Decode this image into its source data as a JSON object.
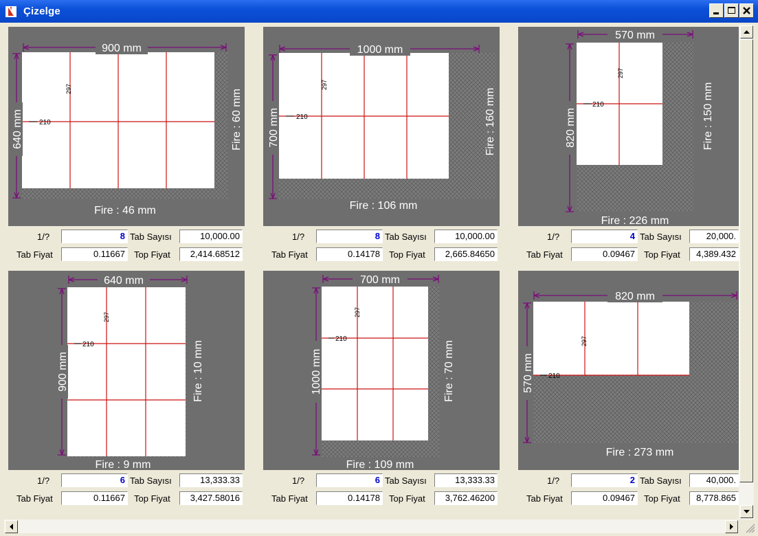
{
  "window": {
    "title": "Çizelge"
  },
  "labels": {
    "ratio": "1/?",
    "tab_count": "Tab Sayısı",
    "tab_price": "Tab Fiyat",
    "total_price": "Top Fiyat"
  },
  "panels": [
    {
      "width_label": "900 mm",
      "height_label": "640 mm",
      "waste_bottom": "Fire : 46 mm",
      "waste_right": "Fire : 60 mm",
      "cell_w": "210",
      "cell_h": "297",
      "ratio": "8",
      "tab_count": "10,000.00",
      "tab_price": "0.11667",
      "total_price": "2,414.68512"
    },
    {
      "width_label": "1000 mm",
      "height_label": "700 mm",
      "waste_bottom": "Fire : 106 mm",
      "waste_right": "Fire : 160 mm",
      "cell_w": "210",
      "cell_h": "297",
      "ratio": "8",
      "tab_count": "10,000.00",
      "tab_price": "0.14178",
      "total_price": "2,665.84650"
    },
    {
      "width_label": "570 mm",
      "height_label": "820 mm",
      "waste_bottom": "Fire : 226 mm",
      "waste_right": "Fire : 150 mm",
      "cell_w": "210",
      "cell_h": "297",
      "ratio": "4",
      "tab_count": "20,000.",
      "tab_price": "0.09467",
      "total_price": "4,389.432"
    },
    {
      "width_label": "640 mm",
      "height_label": "900 mm",
      "waste_bottom": "Fire : 9 mm",
      "waste_right": "Fire : 10 mm",
      "cell_w": "210",
      "cell_h": "297",
      "ratio": "6",
      "tab_count": "13,333.33",
      "tab_price": "0.11667",
      "total_price": "3,427.58016"
    },
    {
      "width_label": "700 mm",
      "height_label": "1000 mm",
      "waste_bottom": "Fire : 109 mm",
      "waste_right": "Fire : 70 mm",
      "cell_w": "210",
      "cell_h": "297",
      "ratio": "6",
      "tab_count": "13,333.33",
      "tab_price": "0.14178",
      "total_price": "3,762.46200"
    },
    {
      "width_label": "820 mm",
      "height_label": "570 mm",
      "waste_bottom": "Fire : 273 mm",
      "waste_right": "",
      "cell_w": "210",
      "cell_h": "297",
      "ratio": "2",
      "tab_count": "40,000.",
      "tab_price": "0.09467",
      "total_price": "8,778.865"
    }
  ]
}
